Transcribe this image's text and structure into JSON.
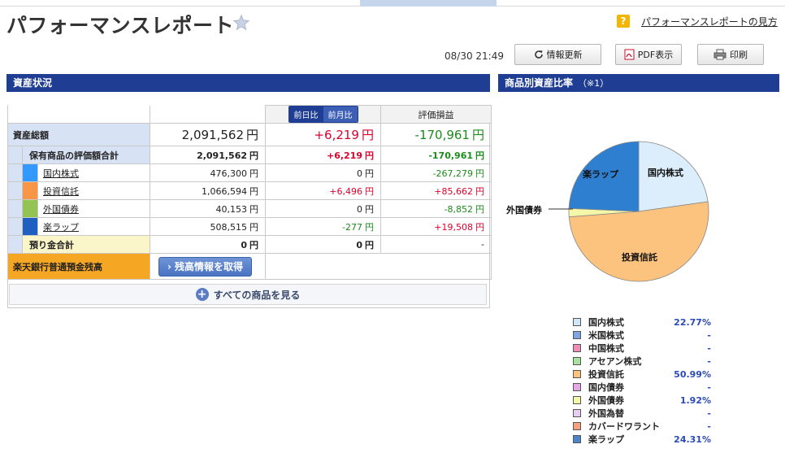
{
  "page": {
    "title": "パフォーマンスレポート",
    "help_link": "パフォーマンスレポートの見方",
    "timestamp": "08/30 21:49"
  },
  "toolbar": {
    "refresh_label": "情報更新",
    "pdf_label": "PDF表示",
    "print_label": "印刷"
  },
  "asset_section": {
    "title": "資産状況",
    "columns": {
      "day_toggle": "前日比",
      "month_toggle": "前月比",
      "valuation": "評価損益"
    },
    "total": {
      "label": "資産総額",
      "value": "2,091,562",
      "change": "+6,219",
      "valuation": "-170,961"
    },
    "holdings_total": {
      "label": "保有商品の評価額合計",
      "value": "2,091,562",
      "change": "+6,219",
      "valuation": "-170,961"
    },
    "items": [
      {
        "name": "国内株式",
        "color": "#3399ff",
        "value": "476,300",
        "change": "0",
        "valuation": "-267,279",
        "val_color": "green",
        "chg_color": "none"
      },
      {
        "name": "投資信託",
        "color": "#f79646",
        "value": "1,066,594",
        "change": "+6,496",
        "valuation": "+85,662",
        "val_color": "red",
        "chg_color": "red"
      },
      {
        "name": "外国債券",
        "color": "#92c353",
        "value": "40,153",
        "change": "0",
        "valuation": "-8,852",
        "val_color": "green",
        "chg_color": "none"
      },
      {
        "name": "楽ラップ",
        "color": "#1f5fbf",
        "value": "508,515",
        "change": "-277",
        "valuation": "+19,508",
        "val_color": "red",
        "chg_color": "green"
      }
    ],
    "deposit": {
      "label": "預り金合計",
      "value": "0",
      "change": "0",
      "valuation": "-"
    },
    "yen": "円",
    "bank": {
      "label": "楽天銀行普通預金残高",
      "button": "残高情報を取得"
    },
    "see_all": "すべての商品を見る"
  },
  "ratio_section": {
    "title": "商品別資産比率",
    "note": "（※1）"
  },
  "chart_data": {
    "type": "pie",
    "slices": [
      {
        "name": "国内株式",
        "value": 22.77,
        "color": "#dceefc"
      },
      {
        "name": "投資信託",
        "value": 50.99,
        "color": "#fbc37d"
      },
      {
        "name": "外国債券",
        "value": 1.92,
        "color": "#f4f7a8"
      },
      {
        "name": "楽ラップ",
        "value": 24.31,
        "color": "#2f7fd1"
      }
    ],
    "labels": [
      "国内株式",
      "投資信託",
      "外国債券",
      "楽ラップ"
    ]
  },
  "legend": [
    {
      "name": "国内株式",
      "value": "22.77%",
      "color": "#cfe6fb"
    },
    {
      "name": "米国株式",
      "value": "-",
      "color": "#7fa4e3"
    },
    {
      "name": "中国株式",
      "value": "-",
      "color": "#f28db8"
    },
    {
      "name": "アセアン株式",
      "value": "-",
      "color": "#a6e3a0"
    },
    {
      "name": "投資信託",
      "value": "50.99%",
      "color": "#fbc37d"
    },
    {
      "name": "国内債券",
      "value": "-",
      "color": "#e5a8e6"
    },
    {
      "name": "外国債券",
      "value": "1.92%",
      "color": "#f4f7a8"
    },
    {
      "name": "外国為替",
      "value": "-",
      "color": "#e6cdf2"
    },
    {
      "name": "カバードワラント",
      "value": "-",
      "color": "#f7a080"
    },
    {
      "name": "楽ラップ",
      "value": "24.31%",
      "color": "#4a86c9"
    }
  ]
}
